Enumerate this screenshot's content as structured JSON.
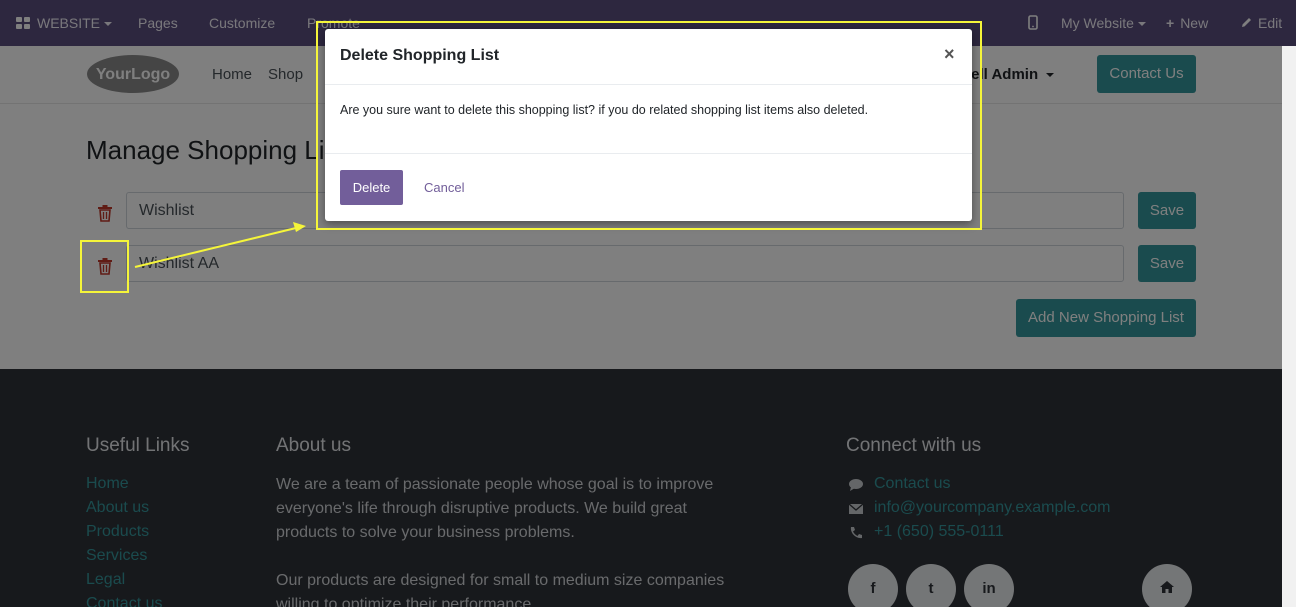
{
  "adminbar": {
    "website_label": "WEBSITE",
    "pages_label": "Pages",
    "customize_label": "Customize",
    "promote_label": "Promote",
    "my_website_label": "My Website",
    "new_label": "New",
    "edit_label": "Edit"
  },
  "header": {
    "logo_text": "YourLogo",
    "nav": [
      "Home",
      "Shop"
    ],
    "user_label": "hell Admin",
    "contact_label": "Contact Us"
  },
  "main": {
    "title": "Manage Shopping List",
    "lists": [
      {
        "name": "Wishlist",
        "save_label": "Save"
      },
      {
        "name": "Wishlist AA",
        "save_label": "Save"
      }
    ],
    "add_label": "Add New Shopping List"
  },
  "footer": {
    "useful_links_heading": "Useful Links",
    "links": [
      "Home",
      "About us",
      "Products",
      "Services",
      "Legal",
      "Contact us"
    ],
    "about_heading": "About us",
    "about_text_1": "We are a team of passionate people whose goal is to improve everyone's life through disruptive products. We build great products to solve your business problems.",
    "about_text_2": "Our products are designed for small to medium size companies willing to optimize their performance.",
    "connect_heading": "Connect with us",
    "contacts": [
      "Contact us",
      "info@yourcompany.example.com",
      "+1 (650) 555-0111"
    ],
    "social": [
      "f",
      "t",
      "in"
    ]
  },
  "modal": {
    "title": "Delete Shopping List",
    "close_glyph": "×",
    "body": "Are you sure want to delete this shopping list? if you do related shopping list items also deleted.",
    "delete_label": "Delete",
    "cancel_label": "Cancel"
  },
  "colors": {
    "adminbar": "#5b4e7e",
    "accent": "#35979c",
    "modal_primary": "#725e9a",
    "highlight": "#f5f53a",
    "trash": "#c0392b",
    "footer_bg": "#2f3338"
  }
}
